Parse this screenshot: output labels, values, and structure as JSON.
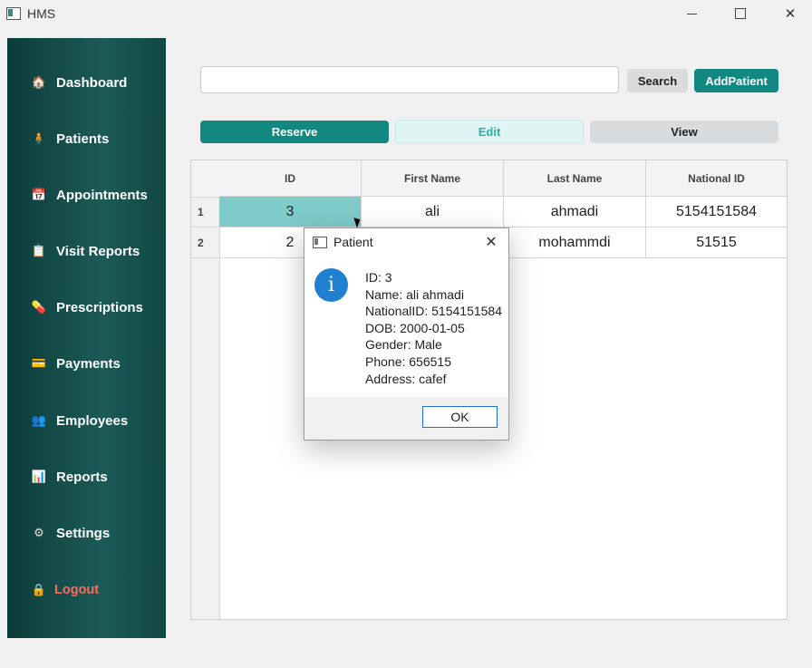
{
  "window": {
    "title": "HMS",
    "minimize_icon": "minimize-icon",
    "maximize_icon": "maximize-icon",
    "close_icon": "close-icon",
    "close_glyph": "✕"
  },
  "sidebar": {
    "items": [
      {
        "label": "Dashboard",
        "icon": "house-icon",
        "glyph": "🏠"
      },
      {
        "label": "Patients",
        "icon": "person-icon",
        "glyph": "🧍"
      },
      {
        "label": "Appointments",
        "icon": "calendar-icon",
        "glyph": "📅"
      },
      {
        "label": "Visit Reports",
        "icon": "clipboard-icon",
        "glyph": "📋"
      },
      {
        "label": "Prescriptions",
        "icon": "pill-icon",
        "glyph": "💊"
      },
      {
        "label": "Payments",
        "icon": "credit-card-icon",
        "glyph": "💳"
      },
      {
        "label": "Employees",
        "icon": "people-icon",
        "glyph": "👥"
      },
      {
        "label": "Reports",
        "icon": "chart-icon",
        "glyph": "📊"
      },
      {
        "label": "Settings",
        "icon": "gear-icon",
        "glyph": "⚙"
      },
      {
        "label": "Logout",
        "icon": "lock-icon",
        "glyph": "🔒"
      }
    ]
  },
  "toolbar": {
    "search_value": "",
    "search_label": "Search",
    "add_patient_label": "AddPatient",
    "reserve_label": "Reserve",
    "edit_label": "Edit",
    "view_label": "View"
  },
  "table": {
    "columns": [
      "ID",
      "First Name",
      "Last Name",
      "National ID"
    ],
    "row_numbers": [
      "1",
      "2"
    ],
    "rows": [
      [
        "3",
        "ali",
        "ahmadi",
        "5154151584"
      ],
      [
        "2",
        "",
        "mohammdi",
        "51515"
      ]
    ]
  },
  "dialog": {
    "title": "Patient",
    "close_glyph": "✕",
    "info_glyph": "i",
    "lines": [
      "ID: 3",
      "Name: ali ahmadi",
      "NationalID: 5154151584",
      "DOB: 2000-01-05",
      "Gender: Male",
      "Phone: 656515",
      "Address: cafef"
    ],
    "ok_label": "OK"
  },
  "colors": {
    "sidebar": "#1c5a57",
    "accent": "#138880",
    "selected_cell": "#7fcbca",
    "logout": "#ff6a5c"
  }
}
